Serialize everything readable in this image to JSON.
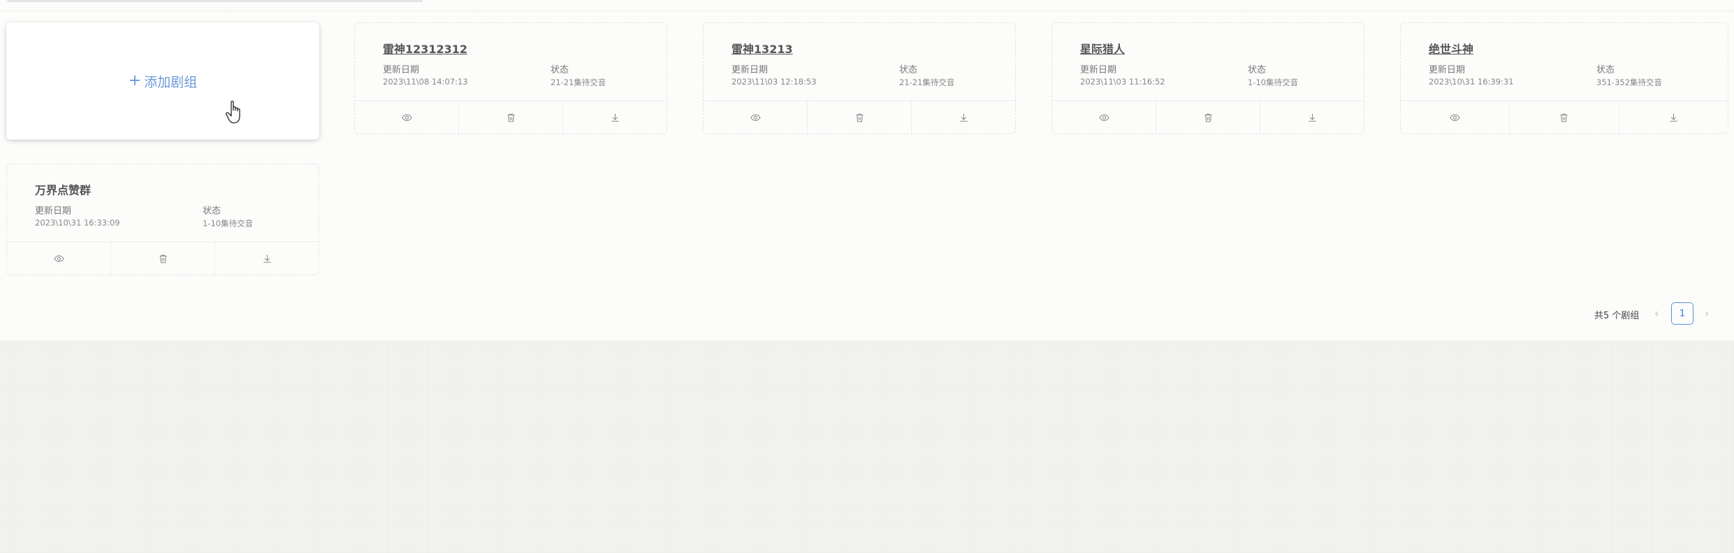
{
  "add_card": {
    "label": "添加剧组"
  },
  "labels": {
    "date": "更新日期",
    "status": "状态"
  },
  "cards": [
    {
      "title": "雷神12312312",
      "date": "2023\\11\\08 14:07:13",
      "status": "21-21集待交音"
    },
    {
      "title": "雷神13213",
      "date": "2023\\11\\03 12:18:53",
      "status": "21-21集待交音"
    },
    {
      "title": "星际猎人",
      "date": "2023\\11\\03 11:16:52",
      "status": "1-10集待交音"
    },
    {
      "title": "绝世斗神",
      "date": "2023\\10\\31 16:39:31",
      "status": "351-352集待交音"
    },
    {
      "title": "万界点赞群",
      "date": "2023\\10\\31 16:33:09",
      "status": "1-10集待交音"
    }
  ],
  "pagination": {
    "total": "共5 个剧组",
    "current_page": "1"
  },
  "colors": {
    "accent": "#5b8fd9",
    "add_text": "#6b9ad8"
  },
  "icons": [
    "eye-icon",
    "trash-icon",
    "download-icon",
    "plus-icon",
    "hand-cursor-icon",
    "chevron-left-icon",
    "chevron-right-icon"
  ]
}
